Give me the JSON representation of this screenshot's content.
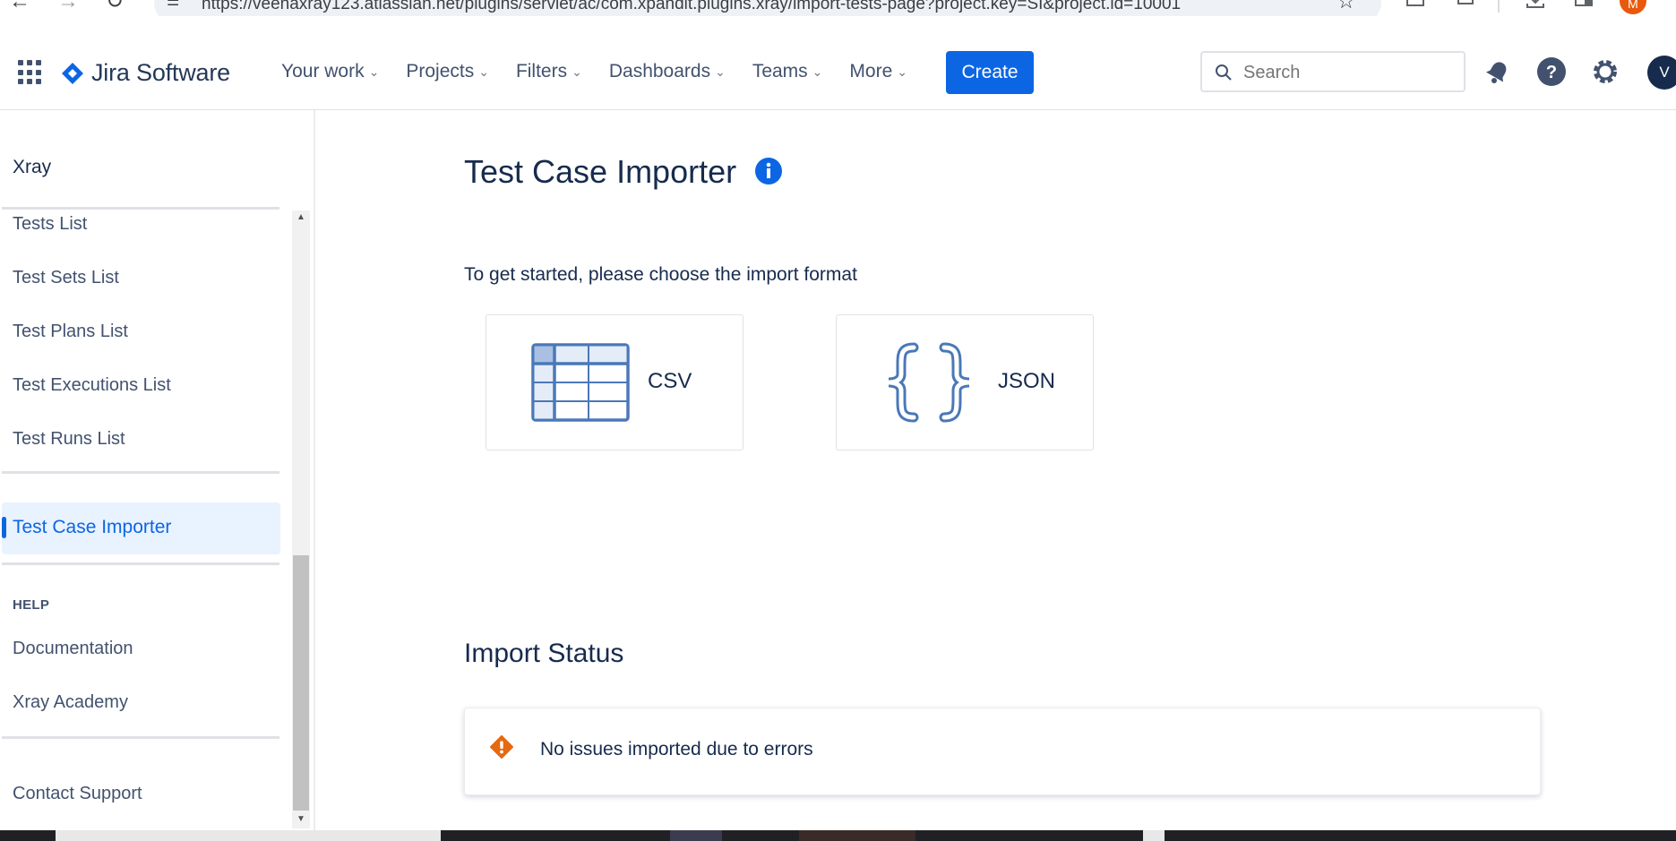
{
  "browser": {
    "url": "https://veenaxray123.atlassian.net/plugins/servlet/ac/com.xpandit.plugins.xray/import-tests-page?project.key=SI&project.id=10001",
    "profile_initial": "M"
  },
  "header": {
    "app_name": "Jira Software",
    "nav_items": [
      {
        "label": "Your work"
      },
      {
        "label": "Projects"
      },
      {
        "label": "Filters"
      },
      {
        "label": "Dashboards"
      },
      {
        "label": "Teams"
      },
      {
        "label": "More"
      }
    ],
    "create_label": "Create",
    "search_placeholder": "Search",
    "avatar_initial": "V"
  },
  "sidebar": {
    "title": "Xray",
    "items": [
      {
        "label": "Tests List"
      },
      {
        "label": "Test Sets List"
      },
      {
        "label": "Test Plans List"
      },
      {
        "label": "Test Executions List"
      },
      {
        "label": "Test Runs List"
      }
    ],
    "active_item": "Test Case Importer",
    "help_heading": "HELP",
    "help_items": [
      {
        "label": "Documentation"
      },
      {
        "label": "Xray Academy"
      }
    ],
    "contact_support": "Contact Support"
  },
  "main": {
    "title": "Test Case Importer",
    "subtitle": "To get started, please choose the import format",
    "formats": [
      {
        "label": "CSV",
        "icon": "table-icon"
      },
      {
        "label": "JSON",
        "icon": "curly-braces-icon"
      }
    ],
    "import_status": {
      "title": "Import Status",
      "message": "No issues imported due to errors",
      "icon": "error-icon"
    }
  },
  "colors": {
    "brand_blue": "#0c66e4",
    "text_dark": "#172b4d",
    "error_orange": "#e56910",
    "icon_blue": "#4a78b8"
  }
}
